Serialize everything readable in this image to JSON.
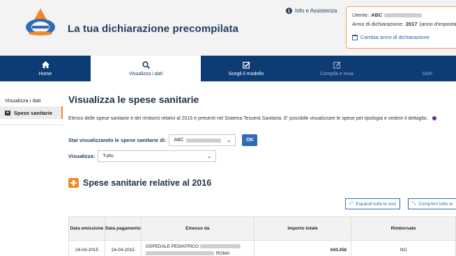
{
  "header": {
    "app_title": "La tua dichiarazione precompilata",
    "info_link": "Info e Assistenza",
    "user_label": "Utente:",
    "user_name": "ABC",
    "year_label": "Anno di dichiarazione:",
    "year_value": "2017",
    "year_suffix": "(anno d'imposta",
    "change_year": "Cambia anno di dichiarazione"
  },
  "nav": {
    "items": [
      {
        "label": "Home",
        "icon": "home-icon"
      },
      {
        "label": "Visualizza i dati",
        "icon": "search-icon"
      },
      {
        "label": "Scegli il modello",
        "icon": "checkbox-icon"
      },
      {
        "label": "Compila e invia",
        "icon": "edit-icon"
      },
      {
        "label": "Dich",
        "icon": ""
      }
    ]
  },
  "sidebar": {
    "title": "Visualizza i dati",
    "active_item": "Spese sanitarie"
  },
  "main": {
    "title": "Visualizza le spese sanitarie",
    "intro": "Elenco delle spese sanitarie e dei rimborsi relativi al 2016 e presenti nel Sistema Tessera Sanitaria. E' possibile visualizzare le spese per tipologia e vedere il dettaglio.",
    "viewing_label": "Stai visualizzando le spese sanitarie di:",
    "viewing_value": "ABC",
    "ok_label": "OK",
    "filter_label": "Visualizza:",
    "filter_value": "Tutto",
    "section_title": "Spese sanitarie relative al 2016",
    "expand_all": "Espandi tutte le voci",
    "collapse_all": "Comprimi tutte le",
    "table": {
      "headers": [
        "Data emissione",
        "Data pagamento",
        "Emesso da",
        "Importo totale",
        "Rimborsato"
      ],
      "rows": [
        {
          "emissione": "24-04-2015",
          "pagamento": "24-04-2015",
          "emesso_da": "OSPEDALE PEDIATRICO",
          "citta": "ROMA",
          "importo": "643.25€",
          "rimborsato": "NO"
        }
      ]
    }
  },
  "colors": {
    "nav_bg": "#0d3b73",
    "accent_orange": "#f08a24",
    "button_blue": "#2f6cb5"
  }
}
